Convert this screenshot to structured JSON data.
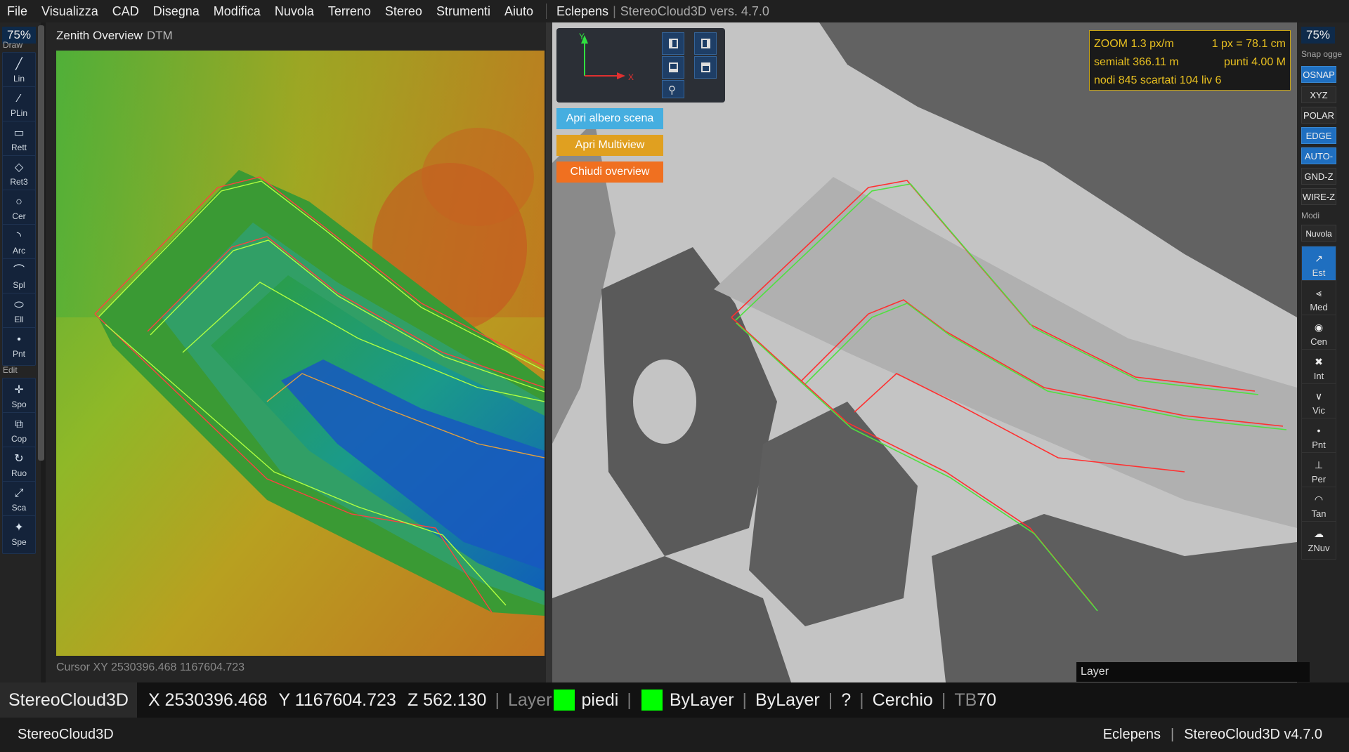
{
  "menu": {
    "items": [
      "File",
      "Visualizza",
      "CAD",
      "Disegna",
      "Modifica",
      "Nuvola",
      "Terreno",
      "Stereo",
      "Strumenti",
      "Aiuto"
    ],
    "project": "Eclepens",
    "version": "StereoCloud3D vers. 4.7.0"
  },
  "left_toolbar": {
    "zoom": "75%",
    "draw_label": "Draw",
    "edit_label": "Edit",
    "draw_tools": [
      {
        "label": "Lin",
        "icon": "line-icon"
      },
      {
        "label": "PLin",
        "icon": "polyline-icon"
      },
      {
        "label": "Rett",
        "icon": "rectangle-icon"
      },
      {
        "label": "Ret3",
        "icon": "rect3-icon"
      },
      {
        "label": "Cer",
        "icon": "circle-icon"
      },
      {
        "label": "Arc",
        "icon": "arc-icon"
      },
      {
        "label": "Spl",
        "icon": "spline-icon"
      },
      {
        "label": "Ell",
        "icon": "ellipse-icon"
      },
      {
        "label": "Pnt",
        "icon": "point-icon"
      }
    ],
    "edit_tools": [
      {
        "label": "Spo",
        "icon": "move-icon"
      },
      {
        "label": "Cop",
        "icon": "copy-icon"
      },
      {
        "label": "Ruo",
        "icon": "rotate-icon"
      },
      {
        "label": "Sca",
        "icon": "scale-icon"
      },
      {
        "label": "Spe",
        "icon": "mirror-icon"
      }
    ]
  },
  "overview": {
    "title": "Zenith Overview",
    "subtitle": "DTM",
    "cursor": "Cursor XY  2530396.468  1167604.723"
  },
  "viewport": {
    "buttons": {
      "scene_tree": "Apri albero scena",
      "multiview": "Apri Multiview",
      "close_overview": "Chiudi overview"
    },
    "gizmo": {
      "x": "X",
      "y": "Y"
    },
    "zoom_info": {
      "line1a": "ZOOM  1.3 px/m",
      "line1b": "1 px = 78.1 cm",
      "line2a": "semialt 366.11 m",
      "line2b": "punti 4.00 M",
      "line3": "nodi 845  scartati 104  liv 6"
    },
    "layer_label": "Layer"
  },
  "right_toolbar": {
    "zoom": "75%",
    "snap_label": "Snap ogge",
    "snaps": [
      {
        "label": "OSNAP",
        "on": true
      },
      {
        "label": "XYZ",
        "on": false
      },
      {
        "label": "POLAR",
        "on": false
      },
      {
        "label": "EDGE",
        "on": true
      },
      {
        "label": "AUTO-Z",
        "on": true
      },
      {
        "label": "GND-Z",
        "on": false
      },
      {
        "label": "WIRE-Z",
        "on": false
      }
    ],
    "modi_label": "Modi",
    "mode": "Nuvola",
    "osnap_tools": [
      {
        "label": "Est",
        "icon": "endpoint-icon",
        "on": true
      },
      {
        "label": "Med",
        "icon": "midpoint-icon",
        "on": false
      },
      {
        "label": "Cen",
        "icon": "center-icon",
        "on": false
      },
      {
        "label": "Int",
        "icon": "intersection-icon",
        "on": false
      },
      {
        "label": "Vic",
        "icon": "nearest-icon",
        "on": false
      },
      {
        "label": "Pnt",
        "icon": "node-icon",
        "on": false
      },
      {
        "label": "Per",
        "icon": "perpendicular-icon",
        "on": false
      },
      {
        "label": "Tan",
        "icon": "tangent-icon",
        "on": false
      },
      {
        "label": "ZNuv",
        "icon": "zcloud-icon",
        "on": false
      }
    ]
  },
  "status": {
    "app": "StereoCloud3D",
    "x": "X 2530396.468",
    "y": "Y 1167604.723",
    "z": "Z 562.130",
    "layer_label": "Layer",
    "layer": "piedi",
    "color": "ByLayer",
    "linetype": "ByLayer",
    "help": "?",
    "command": "Cerchio",
    "tb_prefix": "TB",
    "tb_value": "70",
    "swatch_color": "#00ff00"
  },
  "footer": {
    "left": "StereoCloud3D",
    "project": "Eclepens",
    "separator": "|",
    "version": "StereoCloud3D v4.7.0"
  }
}
